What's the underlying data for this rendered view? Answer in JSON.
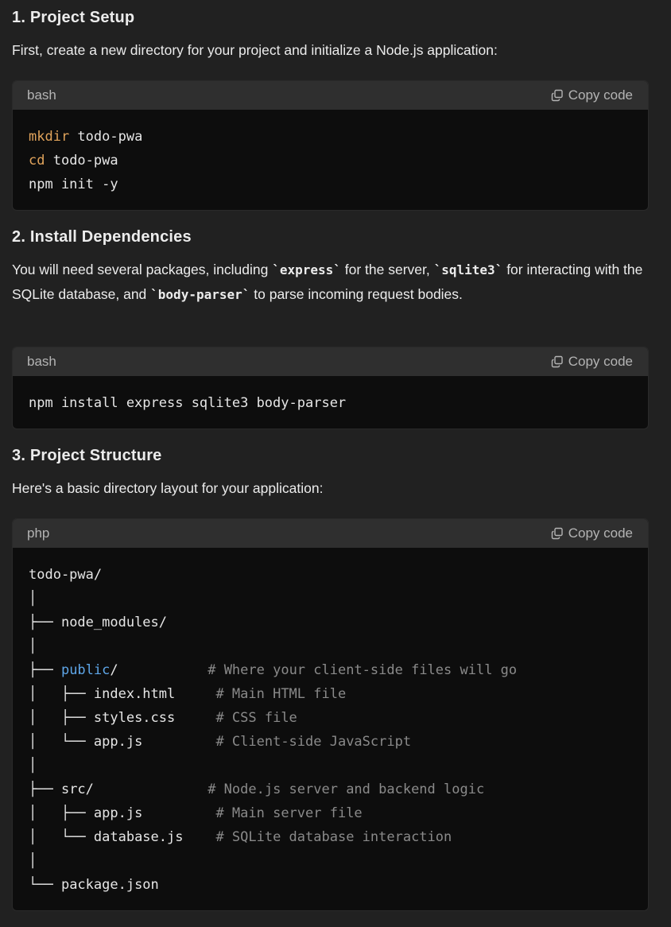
{
  "sections": [
    {
      "heading": "1. Project Setup",
      "paragraph": "First, create a new directory for your project and initialize a Node.js application:",
      "code": {
        "language": "bash",
        "copy_label": "Copy code",
        "lines": [
          {
            "cmd": "mkdir",
            "rest": " todo-pwa"
          },
          {
            "cmd": "cd",
            "rest": " todo-pwa"
          },
          {
            "cmd": "",
            "rest": "npm init -y"
          }
        ]
      }
    },
    {
      "heading": "2. Install Dependencies",
      "paragraph_parts": {
        "t1": "You will need several packages, including ",
        "c1": "`express`",
        "t2": " for the server, ",
        "c2": "`sqlite3`",
        "t3": " for interacting with the SQLite database, and ",
        "c3": "`body-parser`",
        "t4": " to parse incoming request bodies."
      },
      "code": {
        "language": "bash",
        "copy_label": "Copy code",
        "line": "npm install express sqlite3 body-parser"
      }
    },
    {
      "heading": "3. Project Structure",
      "paragraph": "Here's a basic directory layout for your application:",
      "code": {
        "language": "php",
        "copy_label": "Copy code",
        "tree": [
          {
            "prefix": "todo-pwa/",
            "name": "",
            "comment": ""
          },
          {
            "prefix": "│",
            "name": "",
            "comment": ""
          },
          {
            "prefix": "├── ",
            "name": "node_modules/",
            "comment": ""
          },
          {
            "prefix": "│",
            "name": "",
            "comment": ""
          },
          {
            "prefix": "├── ",
            "name": "public",
            "suffix": "/",
            "pad": "           ",
            "comment": "# Where your client-side files will go",
            "highlight": true
          },
          {
            "prefix": "│   ├── ",
            "name": "index.html",
            "pad": "     ",
            "comment": "# Main HTML file"
          },
          {
            "prefix": "│   ├── ",
            "name": "styles.css",
            "pad": "     ",
            "comment": "# CSS file"
          },
          {
            "prefix": "│   └── ",
            "name": "app.js",
            "pad": "         ",
            "comment": "# Client-side JavaScript"
          },
          {
            "prefix": "│",
            "name": "",
            "comment": ""
          },
          {
            "prefix": "├── ",
            "name": "src/",
            "pad": "              ",
            "comment": "# Node.js server and backend logic"
          },
          {
            "prefix": "│   ├── ",
            "name": "app.js",
            "pad": "         ",
            "comment": "# Main server file"
          },
          {
            "prefix": "│   └── ",
            "name": "database.js",
            "pad": "    ",
            "comment": "# SQLite database interaction"
          },
          {
            "prefix": "│",
            "name": "",
            "comment": ""
          },
          {
            "prefix": "└── ",
            "name": "package.json",
            "comment": ""
          }
        ]
      }
    }
  ],
  "colors": {
    "background": "#212121",
    "code_bg": "#0d0d0d",
    "header_bg": "#2f2f2f",
    "keyword": "#e0a35b",
    "folder_highlight": "#5ea6e8",
    "comment": "#8a8a8a"
  }
}
